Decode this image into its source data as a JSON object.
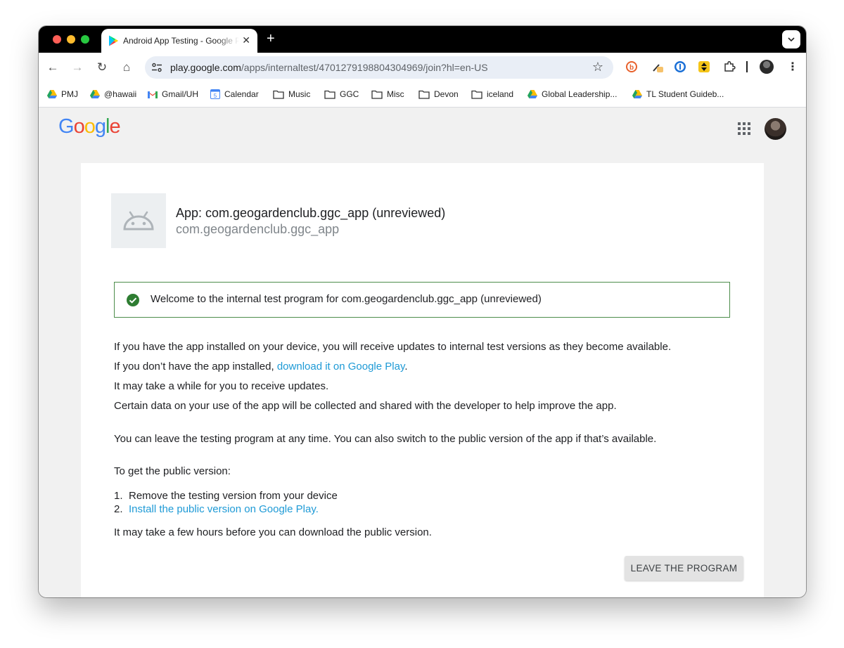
{
  "browser": {
    "tab_title": "Android App Testing - Google Play",
    "tab_close": "✕",
    "new_tab": "+",
    "tab_menu": "⌄",
    "url_host": "play.google.com",
    "url_path": "/apps/internaltest/4701279198804304969/join?hl=en-US",
    "star": "☆",
    "kebab": "⋮",
    "back": "←",
    "forward": "→",
    "reload": "↻",
    "home": "⌂"
  },
  "bookmarks": [
    {
      "label": "PMJ",
      "icon": "drive-icon"
    },
    {
      "label": "@hawaii",
      "icon": "drive-icon"
    },
    {
      "label": "Gmail/UH",
      "icon": "gmail-icon"
    },
    {
      "label": "Calendar",
      "icon": "calendar-icon"
    },
    {
      "label": "Music",
      "icon": "folder-icon"
    },
    {
      "label": "GGC",
      "icon": "folder-icon"
    },
    {
      "label": "Misc",
      "icon": "folder-icon"
    },
    {
      "label": "Devon",
      "icon": "folder-icon"
    },
    {
      "label": "iceland",
      "icon": "folder-icon"
    },
    {
      "label": "Global Leadership...",
      "icon": "drive-icon"
    },
    {
      "label": "TL Student Guideb...",
      "icon": "drive-icon"
    }
  ],
  "header": {
    "logo": [
      "G",
      "o",
      "o",
      "g",
      "l",
      "e"
    ],
    "logo_colors": [
      "#4285f4",
      "#ea4335",
      "#fbbc05",
      "#4285f4",
      "#34a853",
      "#ea4335"
    ]
  },
  "app": {
    "title": "App: com.geogardenclub.ggc_app (unreviewed)",
    "package": "com.geogardenclub.ggc_app"
  },
  "welcome": "Welcome to the internal test program for com.geogardenclub.ggc_app (unreviewed)",
  "body": {
    "p1": "If you have the app installed on your device, you will receive updates to internal test versions as they become available.",
    "p2_prefix": "If you don’t have the app installed, ",
    "p2_link": "download it on Google Play",
    "p2_suffix": ".",
    "p3": "It may take a while for you to receive updates.",
    "p4": "Certain data on your use of the app will be collected and shared with the developer to help improve the app.",
    "p5": "You can leave the testing program at any time. You can also switch to the public version of the app if that’s available.",
    "p6": "To get the public version:",
    "step1_num": "1.",
    "step1": "Remove the testing version from your device",
    "step2_num": "2.",
    "step2_link": "Install the public version on Google Play.",
    "p7": "It may take a few hours before you can download the public version."
  },
  "leave_button": "LEAVE THE PROGRAM",
  "colors": {
    "link": "#1e9ad6",
    "success_border": "#4c8c4a",
    "success_check": "#2e7d32"
  }
}
